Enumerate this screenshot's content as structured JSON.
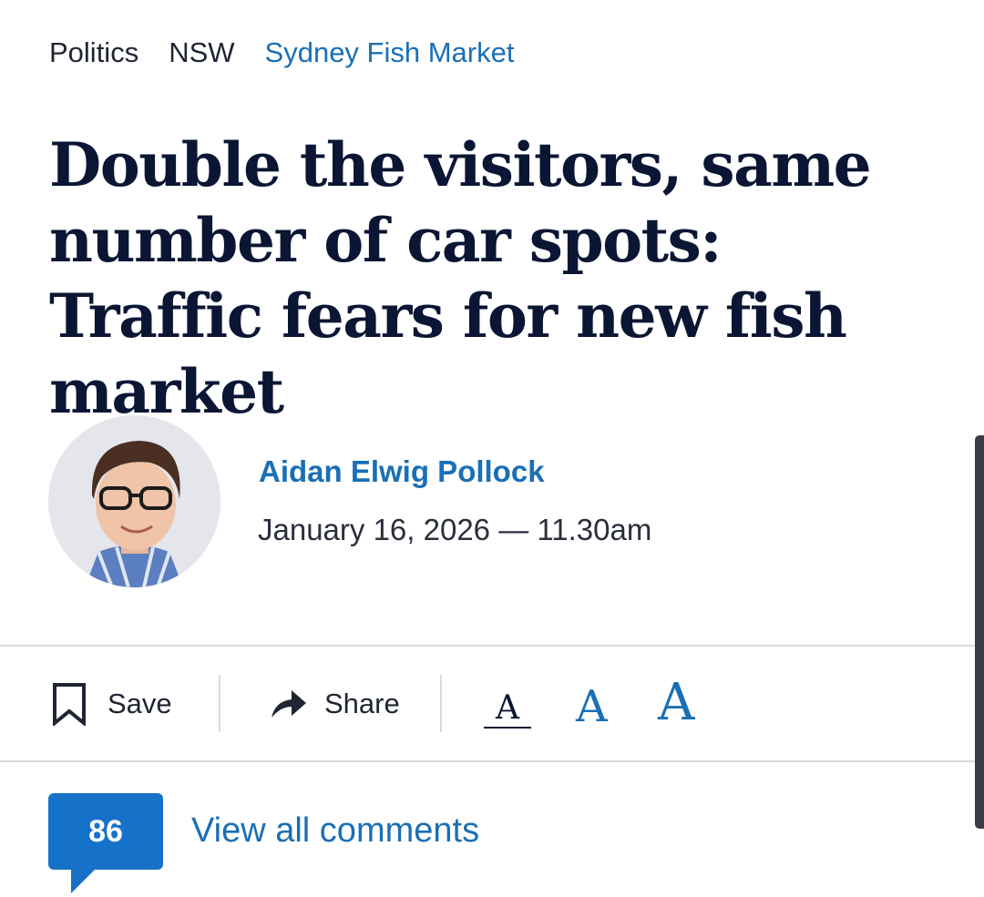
{
  "breadcrumbs": [
    {
      "label": "Politics"
    },
    {
      "label": "NSW"
    },
    {
      "label": "Sydney Fish Market"
    }
  ],
  "headline": "Double the visitors, same number of car spots: Traffic fears for new fish market",
  "byline": {
    "author": "Aidan Elwig Pollock",
    "datetime": "January 16, 2026 — 11.30am"
  },
  "toolbar": {
    "save_label": "Save",
    "share_label": "Share",
    "font_sizes": [
      "A",
      "A",
      "A"
    ]
  },
  "comments": {
    "count": "86",
    "link_label": "View all comments"
  },
  "colors": {
    "accent": "#1a6fb5",
    "badge": "#1672c8",
    "headline": "#0a1633"
  }
}
